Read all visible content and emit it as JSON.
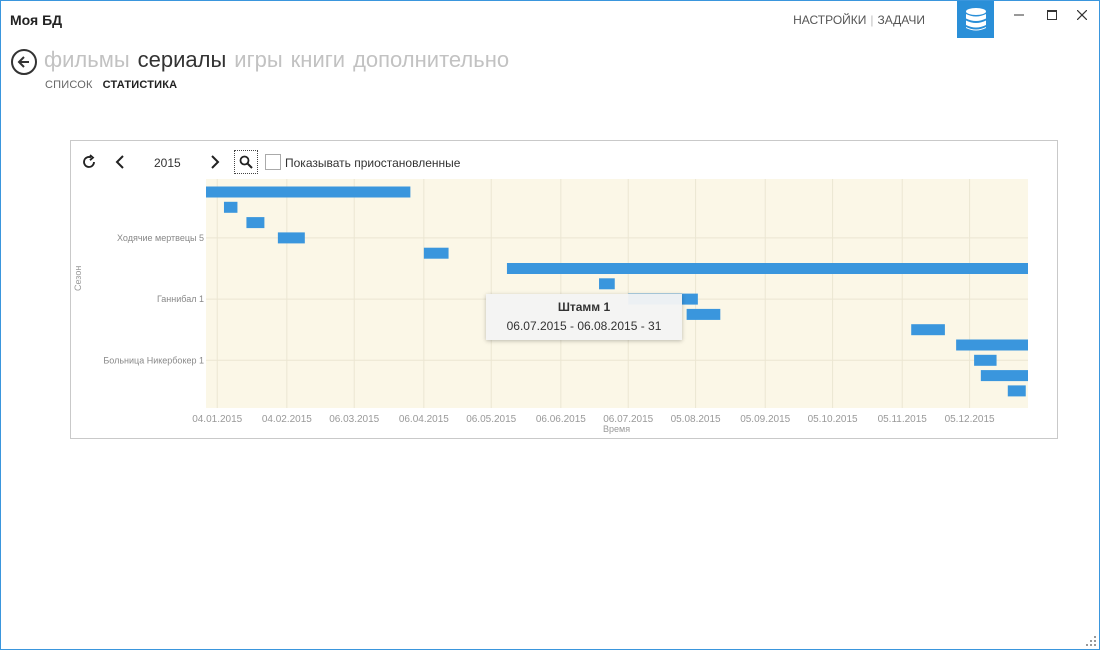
{
  "app": {
    "title": "Моя БД"
  },
  "top_links": {
    "settings": "НАСТРОЙКИ",
    "tasks": "ЗАДАЧИ"
  },
  "icons": {
    "back": "back-arrow-icon",
    "database": "database-icon",
    "refresh": "refresh-icon",
    "prev": "chevron-left-icon",
    "next": "chevron-right-icon",
    "search": "search-icon"
  },
  "colors": {
    "accent": "#2a8fd8",
    "bar": "#3a96dd",
    "plot_bg": "#fbf7e7"
  },
  "nav": {
    "tabs": [
      {
        "label": "фильмы",
        "active": false
      },
      {
        "label": "сериалы",
        "active": true
      },
      {
        "label": "игры",
        "active": false
      },
      {
        "label": "книги",
        "active": false
      },
      {
        "label": "дополнительно",
        "active": false
      }
    ],
    "subtabs": [
      {
        "label": "СПИСОК",
        "active": false
      },
      {
        "label": "СТАТИСТИКА",
        "active": true
      }
    ]
  },
  "toolbar": {
    "year": "2015",
    "show_paused_label": "Показывать приостановленные",
    "show_paused_checked": false
  },
  "chart_data": {
    "type": "gantt",
    "xlabel": "Время",
    "ylabel": "Сезон",
    "x_range": [
      "2014-12-30",
      "2015-12-31"
    ],
    "x_ticks": [
      "04.01.2015",
      "04.02.2015",
      "06.03.2015",
      "06.04.2015",
      "06.05.2015",
      "06.06.2015",
      "06.07.2015",
      "05.08.2015",
      "05.09.2015",
      "05.10.2015",
      "05.11.2015",
      "05.12.2015"
    ],
    "y_labels": [
      {
        "label": "Ходячие мертвецы 5",
        "row": 3
      },
      {
        "label": "Ганнибал 1",
        "row": 7
      },
      {
        "label": "Больница Никербокер 1",
        "row": 11
      }
    ],
    "grid": true,
    "bars": [
      {
        "row": 0,
        "start": "2014-12-30",
        "end": "2015-03-31"
      },
      {
        "row": 1,
        "start": "2015-01-07",
        "end": "2015-01-13"
      },
      {
        "row": 2,
        "start": "2015-01-17",
        "end": "2015-01-25"
      },
      {
        "row": 3,
        "start": "2015-01-31",
        "end": "2015-02-12"
      },
      {
        "row": 4,
        "start": "2015-04-06",
        "end": "2015-04-17"
      },
      {
        "row": 5,
        "start": "2015-05-13",
        "end": "2015-12-31"
      },
      {
        "row": 6,
        "start": "2015-06-23",
        "end": "2015-06-30"
      },
      {
        "row": 7,
        "start": "2015-07-06",
        "end": "2015-08-06"
      },
      {
        "row": 8,
        "start": "2015-08-01",
        "end": "2015-08-16"
      },
      {
        "row": 9,
        "start": "2015-11-09",
        "end": "2015-11-24"
      },
      {
        "row": 10,
        "start": "2015-11-29",
        "end": "2015-12-31"
      },
      {
        "row": 11,
        "start": "2015-12-07",
        "end": "2015-12-17"
      },
      {
        "row": 12,
        "start": "2015-12-10",
        "end": "2015-12-31"
      },
      {
        "row": 13,
        "start": "2015-12-22",
        "end": "2015-12-30"
      }
    ],
    "tooltip": {
      "title": "Штамм 1",
      "text": "06.07.2015 - 06.08.2015 - 31"
    }
  }
}
